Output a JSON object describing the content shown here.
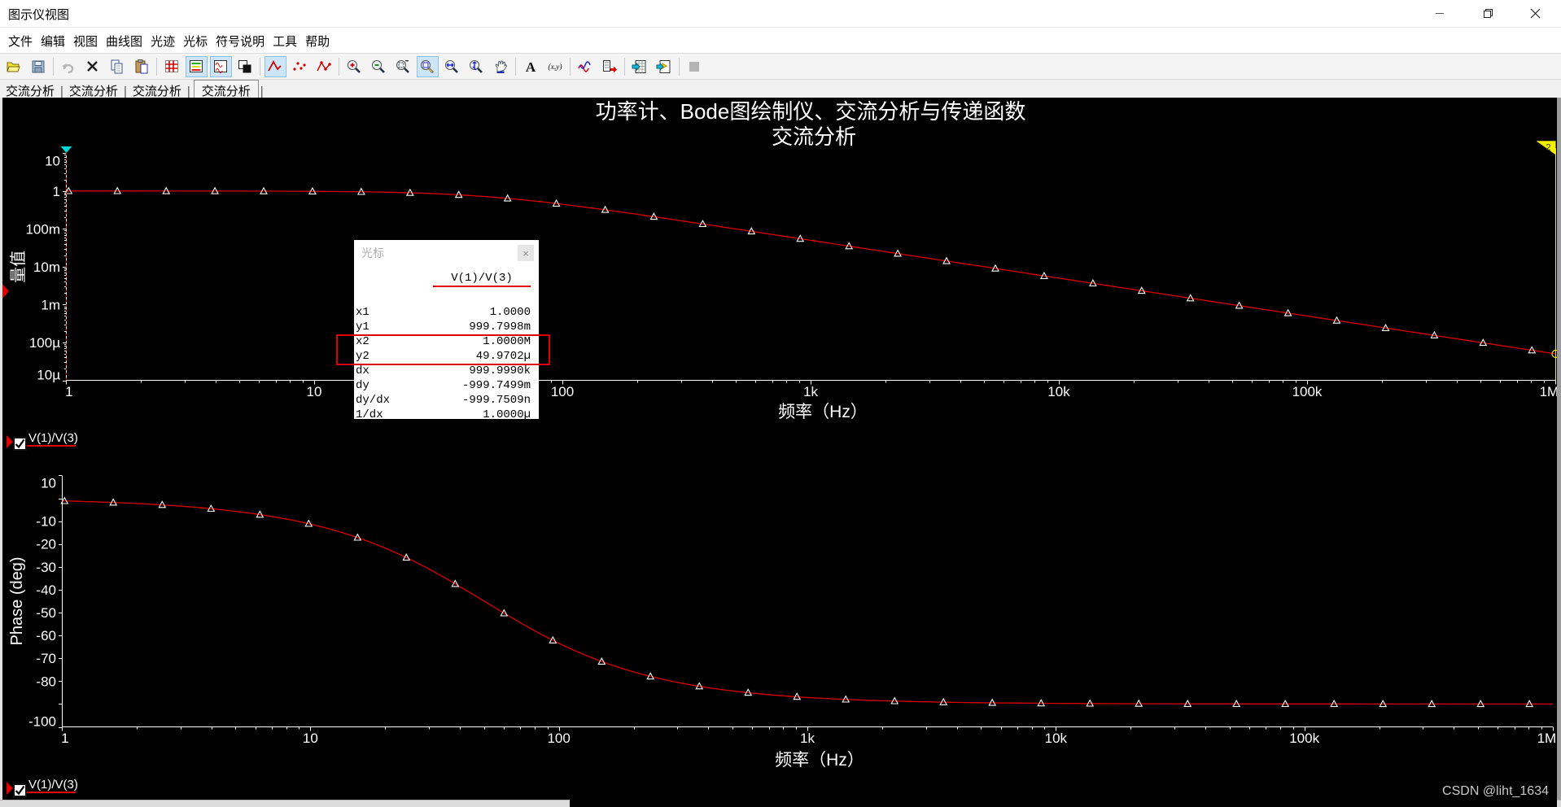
{
  "window": {
    "title": "图示仪视图"
  },
  "menu": {
    "items": [
      "文件",
      "编辑",
      "视图",
      "曲线图",
      "光迹",
      "光标",
      "符号说明",
      "工具",
      "帮助"
    ]
  },
  "toolbar": {
    "buttons": [
      {
        "name": "open-file"
      },
      {
        "name": "save",
        "group_end": true
      },
      {
        "name": "undo",
        "disabled": true
      },
      {
        "name": "delete"
      },
      {
        "name": "copy"
      },
      {
        "name": "paste",
        "group_end": true
      },
      {
        "name": "grid"
      },
      {
        "name": "show-legend",
        "selected": true
      },
      {
        "name": "show-graphs",
        "selected": true
      },
      {
        "name": "overlay-traces",
        "group_end": true
      },
      {
        "name": "trace-line",
        "selected": true
      },
      {
        "name": "trace-dots"
      },
      {
        "name": "trace-line-dots",
        "group_end": true
      },
      {
        "name": "zoom-in"
      },
      {
        "name": "zoom-out"
      },
      {
        "name": "zoom-window"
      },
      {
        "name": "zoom-fit",
        "selected": true
      },
      {
        "name": "zoom-horizontal"
      },
      {
        "name": "zoom-vertical"
      },
      {
        "name": "pan-hand",
        "group_end": true
      },
      {
        "name": "add-text"
      },
      {
        "name": "show-coordinates",
        "group_end": true
      },
      {
        "name": "overlay-curves"
      },
      {
        "name": "export-data",
        "group_end": true
      },
      {
        "name": "export-excel"
      },
      {
        "name": "export-labview",
        "group_end": true
      },
      {
        "name": "stop",
        "disabled": true
      }
    ]
  },
  "tabs": {
    "items": [
      "交流分析",
      "交流分析",
      "交流分析",
      "交流分析"
    ],
    "active_index": 3
  },
  "plot_title": {
    "line1": "功率计、Bode图绘制仪、交流分析与传递函数",
    "line2": "交流分析"
  },
  "chart_data": [
    {
      "type": "line",
      "name": "magnitude-plot",
      "xlabel": "频率（Hz）",
      "ylabel": "量值",
      "xscale": "log",
      "yscale": "log",
      "xlim": [
        1,
        1000000
      ],
      "ylim": [
        1e-05,
        10
      ],
      "xticks": [
        "1",
        "10",
        "100",
        "1k",
        "10k",
        "100k",
        "1M"
      ],
      "yticks": [
        {
          "value": 10,
          "label": "10"
        },
        {
          "value": 1,
          "label": "1"
        },
        {
          "value": 0.1,
          "label": "100m"
        },
        {
          "value": 0.01,
          "label": "10m"
        },
        {
          "value": 0.001,
          "label": "1m"
        },
        {
          "value": 0.0001,
          "label": "100µ"
        },
        {
          "value": 1e-05,
          "label": "10µ"
        }
      ],
      "series": [
        {
          "name": "V(1)/V(3)",
          "color": "#dd0000",
          "model": {
            "kind": "first-order-lowpass-magnitude",
            "fc_hz": 50
          },
          "markers": [
            [
              1.025,
              0.9998
            ],
            [
              1.611,
              0.9995
            ],
            [
              2.534,
              0.9987
            ],
            [
              3.983,
              0.9968
            ],
            [
              6.262,
              0.9922
            ],
            [
              9.845,
              0.981
            ],
            [
              15.48,
              0.9553
            ],
            [
              24.34,
              0.8991
            ],
            [
              38.26,
              0.7941
            ],
            [
              60.15,
              0.6392
            ],
            [
              94.57,
              0.4673
            ],
            [
              148.7,
              0.3187
            ],
            [
              233.7,
              0.2092
            ],
            [
              367.4,
              0.1348
            ],
            [
              577.7,
              0.08627
            ],
            [
              908.2,
              0.05499
            ],
            [
              1428,
              0.035
            ],
            [
              2245,
              0.02227
            ],
            [
              3529,
              0.01417
            ],
            [
              5549,
              0.009011
            ],
            [
              8724,
              0.005731
            ],
            [
              13716,
              0.003645
            ],
            [
              21563,
              0.002319
            ],
            [
              33900,
              0.001475
            ],
            [
              53299,
              0.000938
            ],
            [
              83796,
              0.000597
            ],
            [
              131743,
              0.00038
            ],
            [
              207132,
              0.000241
            ],
            [
              325632,
              0.000154
            ],
            [
              512000,
              9.77e-05
            ],
            [
              804871,
              6.21e-05
            ]
          ]
        }
      ],
      "cursors": [
        {
          "id": 1,
          "x": 1,
          "flag_color": "#00d8d8",
          "line_style": "dashed",
          "line_color": "#dd0000"
        },
        {
          "id": 2,
          "x": 1000000,
          "flag_color": "#f3ef00",
          "line_style": "solid",
          "line_color": "#f3ef00"
        }
      ]
    },
    {
      "type": "line",
      "name": "phase-plot",
      "xlabel": "频率（Hz）",
      "ylabel": "Phase (deg)",
      "xscale": "log",
      "yscale": "linear",
      "xlim": [
        1,
        1000000
      ],
      "ylim": [
        -100,
        10
      ],
      "xticks": [
        "1",
        "10",
        "100",
        "1k",
        "10k",
        "100k",
        "1M"
      ],
      "yticks": [
        {
          "value": 10,
          "label": "10"
        },
        {
          "value": 0,
          "label": ""
        },
        {
          "value": -10,
          "label": "-10"
        },
        {
          "value": -20,
          "label": "-20"
        },
        {
          "value": -30,
          "label": "-30"
        },
        {
          "value": -40,
          "label": "-40"
        },
        {
          "value": -50,
          "label": "-50"
        },
        {
          "value": -60,
          "label": "-60"
        },
        {
          "value": -70,
          "label": "-70"
        },
        {
          "value": -80,
          "label": "-80"
        },
        {
          "value": -90,
          "label": ""
        },
        {
          "value": -100,
          "label": "-100"
        }
      ],
      "series": [
        {
          "name": "V(1)/V(3)",
          "color": "#dd0000",
          "model": {
            "kind": "first-order-lowpass-phase",
            "fc_hz": 50
          },
          "markers": [
            [
              1.025,
              -1.17
            ],
            [
              1.611,
              -1.85
            ],
            [
              2.534,
              -2.9
            ],
            [
              3.983,
              -4.56
            ],
            [
              6.262,
              -7.14
            ],
            [
              9.845,
              -11.14
            ],
            [
              15.48,
              -17.2
            ],
            [
              24.34,
              -25.96
            ],
            [
              38.26,
              -37.43
            ],
            [
              60.15,
              -50.27
            ],
            [
              94.57,
              -62.13
            ],
            [
              148.7,
              -71.41
            ],
            [
              233.7,
              -77.93
            ],
            [
              367.4,
              -82.25
            ],
            [
              577.7,
              -85.05
            ],
            [
              908.2,
              -86.85
            ],
            [
              1428,
              -87.99
            ],
            [
              2245,
              -88.72
            ],
            [
              3529,
              -89.19
            ],
            [
              5549,
              -89.48
            ],
            [
              8724,
              -89.67
            ],
            [
              13716,
              -89.79
            ],
            [
              21563,
              -89.87
            ],
            [
              33900,
              -89.92
            ],
            [
              53299,
              -89.95
            ],
            [
              83796,
              -89.97
            ],
            [
              131743,
              -89.978
            ],
            [
              207132,
              -89.986
            ],
            [
              325632,
              -89.991
            ],
            [
              512000,
              -89.994
            ],
            [
              804871,
              -89.996
            ]
          ]
        }
      ],
      "cursors": []
    }
  ],
  "cursor_panel": {
    "title": "光标",
    "column_header": "V(1)/V(3)",
    "rows": [
      [
        "x1",
        "1.0000"
      ],
      [
        "y1",
        "999.7998m"
      ],
      [
        "x2",
        "1.0000M"
      ],
      [
        "y2",
        "49.9702µ"
      ],
      [
        "dx",
        "999.9990k"
      ],
      [
        "dy",
        "-999.7499m"
      ],
      [
        "dy/dx",
        "-999.7509n"
      ],
      [
        "1/dx",
        "1.0000µ"
      ]
    ],
    "highlighted_rows": [
      2,
      3
    ]
  },
  "legends": [
    {
      "label": "V(1)/V(3)",
      "checked": true
    },
    {
      "label": "V(1)/V(3)",
      "checked": true
    }
  ],
  "watermark": "CSDN @liht_1634"
}
